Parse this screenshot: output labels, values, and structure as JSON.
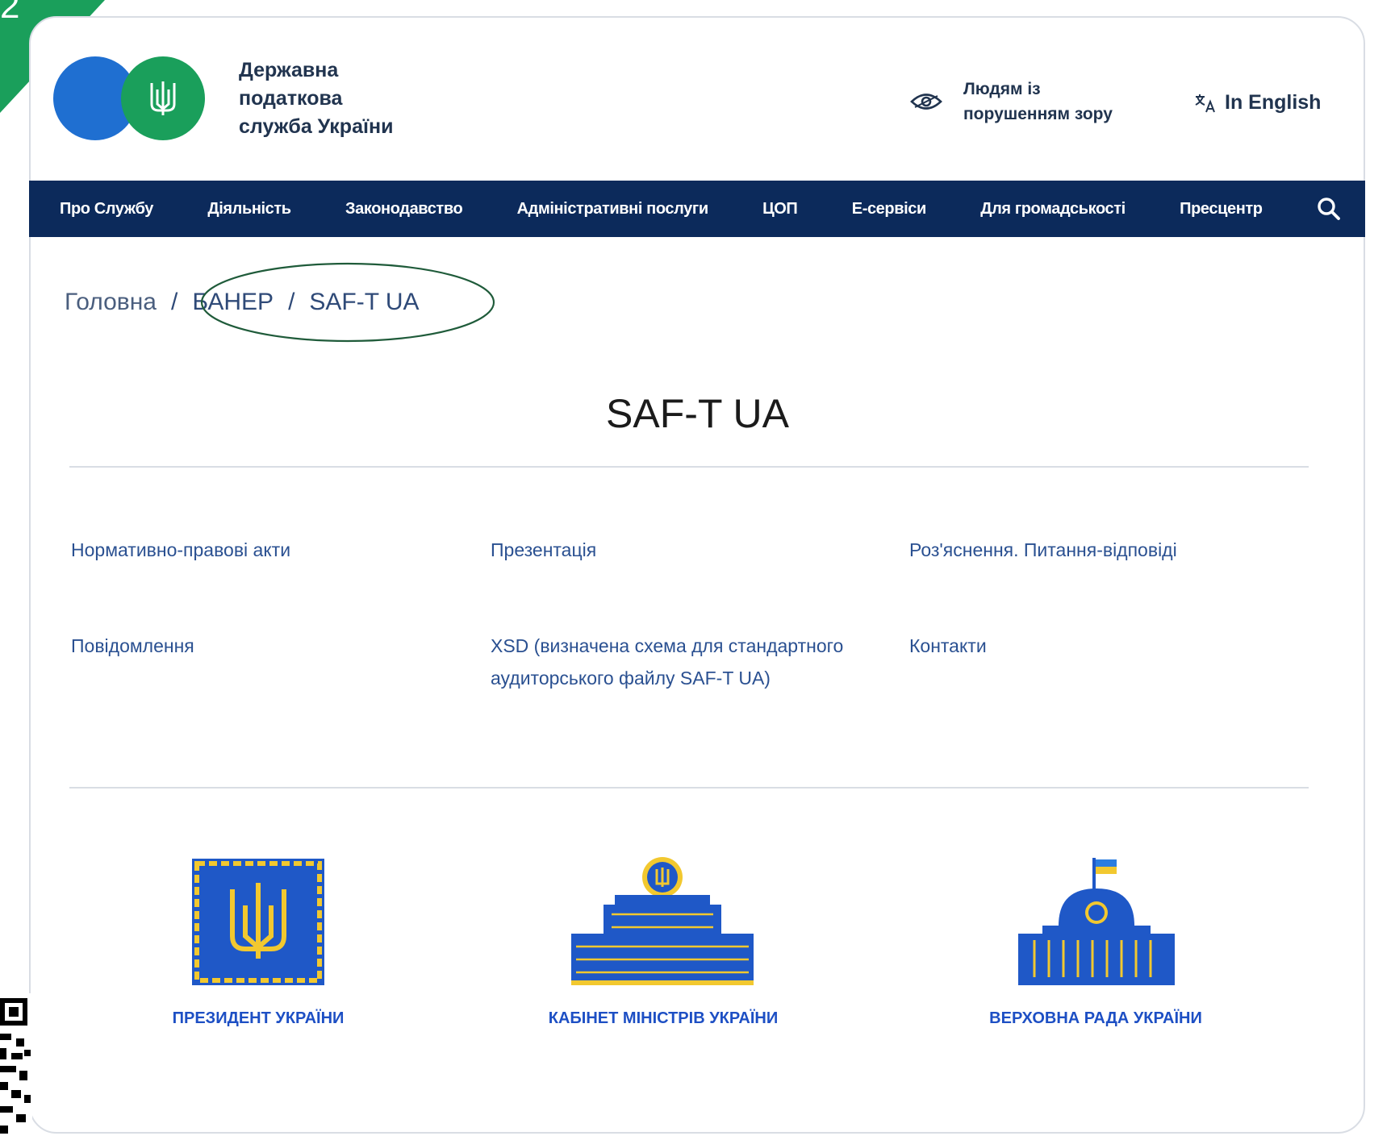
{
  "corner": {
    "number": "2"
  },
  "header": {
    "org_name_lines": [
      "Державна",
      "податкова",
      "служба України"
    ],
    "vision_lines": [
      "Людям із",
      "порушенням зору"
    ],
    "language_label": "In English"
  },
  "nav": {
    "items": [
      "Про Службу",
      "Діяльність",
      "Законодавство",
      "Адміністративні послуги",
      "ЦОП",
      "Е-сервіси",
      "Для громадськості",
      "Пресцентр"
    ]
  },
  "breadcrumb": {
    "home": "Головна",
    "separator": "/",
    "items": [
      "БАНЕР",
      "SAF-T UA"
    ]
  },
  "page": {
    "title": "SAF-T UA"
  },
  "links": [
    "Нормативно-правові акти",
    "Презентація",
    "Роз'яснення. Питання-відповіді",
    "Повідомлення",
    "XSD (визначена схема для стандартного аудиторського файлу SAF-T UA)",
    "Контакти"
  ],
  "institutions": [
    {
      "label": "ПРЕЗИДЕНТ УКРАЇНИ",
      "icon": "president-emblem-icon"
    },
    {
      "label": "КАБІНЕТ МІНІСТРІВ УКРАЇНИ",
      "icon": "cabinet-building-icon"
    },
    {
      "label": "ВЕРХОВНА РАДА УКРАЇНИ",
      "icon": "parliament-building-icon"
    }
  ],
  "colors": {
    "nav_background": "#0c2a5b",
    "accent_green": "#1a9f5b",
    "accent_blue": "#1f6fd1",
    "link_color": "#2a5091",
    "institution_blue": "#1d4fc4",
    "emblem_yellow": "#f2c82f"
  },
  "icons": [
    "trident-icon",
    "eye-icon",
    "translate-icon",
    "search-icon"
  ]
}
